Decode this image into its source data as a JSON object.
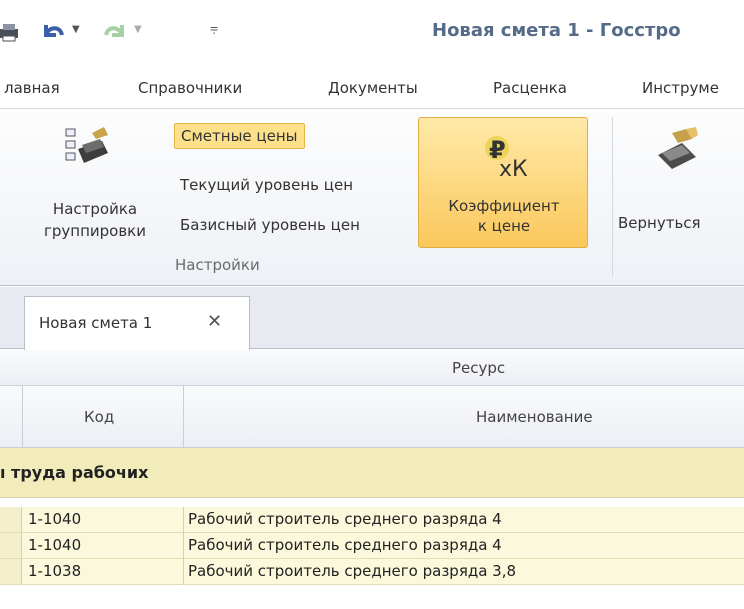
{
  "titlebar": {
    "title": "Новая смета 1 - Госстро"
  },
  "ribbon_tabs": [
    "лавная",
    "Справочники",
    "Документы",
    "Расценка",
    "Инструме"
  ],
  "ribbon": {
    "grouping_button": {
      "line1": "Настройка",
      "line2": "группировки",
      "icon": "grouping-settings-icon"
    },
    "price_options": [
      "Сметные цены",
      "Текущий уровень цен",
      "Базисный уровень цен"
    ],
    "group_label": "Настройки",
    "coefficient_button": {
      "line1": "Коэффициент",
      "line2": "к цене",
      "icon_text": "₽",
      "icon_sub": "хК"
    },
    "return_button": {
      "label": "Вернуться",
      "icon": "return-icon"
    }
  },
  "document_tab": {
    "label": "Новая смета 1",
    "close": "✕"
  },
  "grid": {
    "resource_header": "Ресурс",
    "columns": {
      "code": "Код",
      "name": "Наименование"
    },
    "group_title": "ı труда рабочих",
    "rows": [
      {
        "code": "1-1040",
        "name": "Рабочий строитель среднего разряда 4"
      },
      {
        "code": "1-1040",
        "name": "Рабочий строитель среднего разряда 4"
      },
      {
        "code": "1-1038",
        "name": "Рабочий строитель среднего разряда 3,8"
      }
    ]
  },
  "colors": {
    "accent_orange": "#fbc85c",
    "title_blue": "#556b87",
    "group_row": "#f1ecb9"
  }
}
